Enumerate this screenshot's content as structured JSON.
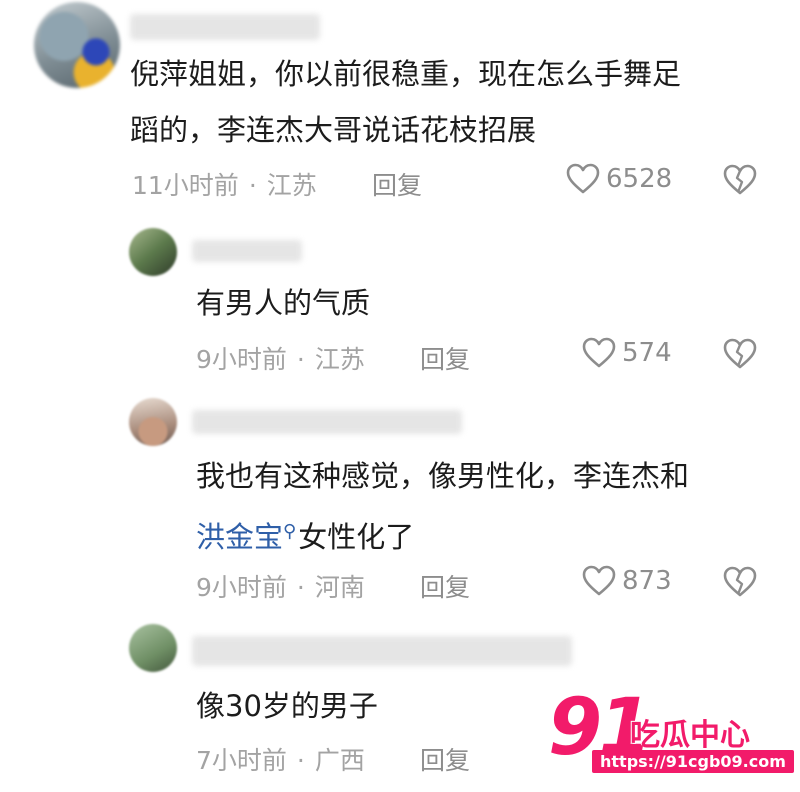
{
  "comments": [
    {
      "text_line1": "倪萍姐姐，你以前很稳重，现在怎么手舞足",
      "text_line2": "蹈的，李连杰大哥说话花枝招展",
      "time": "11小时前",
      "location": "江苏",
      "reply_label": "回复",
      "likes": "6528"
    }
  ],
  "replies": [
    {
      "text": "有男人的气质",
      "time": "9小时前",
      "location": "江苏",
      "reply_label": "回复",
      "likes": "574"
    },
    {
      "text_line1": "我也有这种感觉，像男性化，李连杰和",
      "link_text": "洪金宝",
      "text_after_link": "女性化了",
      "time": "9小时前",
      "location": "河南",
      "reply_label": "回复",
      "likes": "873"
    },
    {
      "text": "像30岁的男子",
      "time": "7小时前",
      "location": "广西",
      "reply_label": "回复"
    }
  ],
  "meta_separator": "·",
  "icons": {
    "like": "heart-outline-icon",
    "dislike": "broken-heart-icon",
    "search": "search-icon"
  },
  "colors": {
    "link": "#2f5fa8",
    "meta": "#a3a3a3",
    "watermark": "#f21b6a"
  },
  "watermark": {
    "number": "91",
    "name": "吃瓜中心",
    "url": "https://91cgb09.com"
  }
}
